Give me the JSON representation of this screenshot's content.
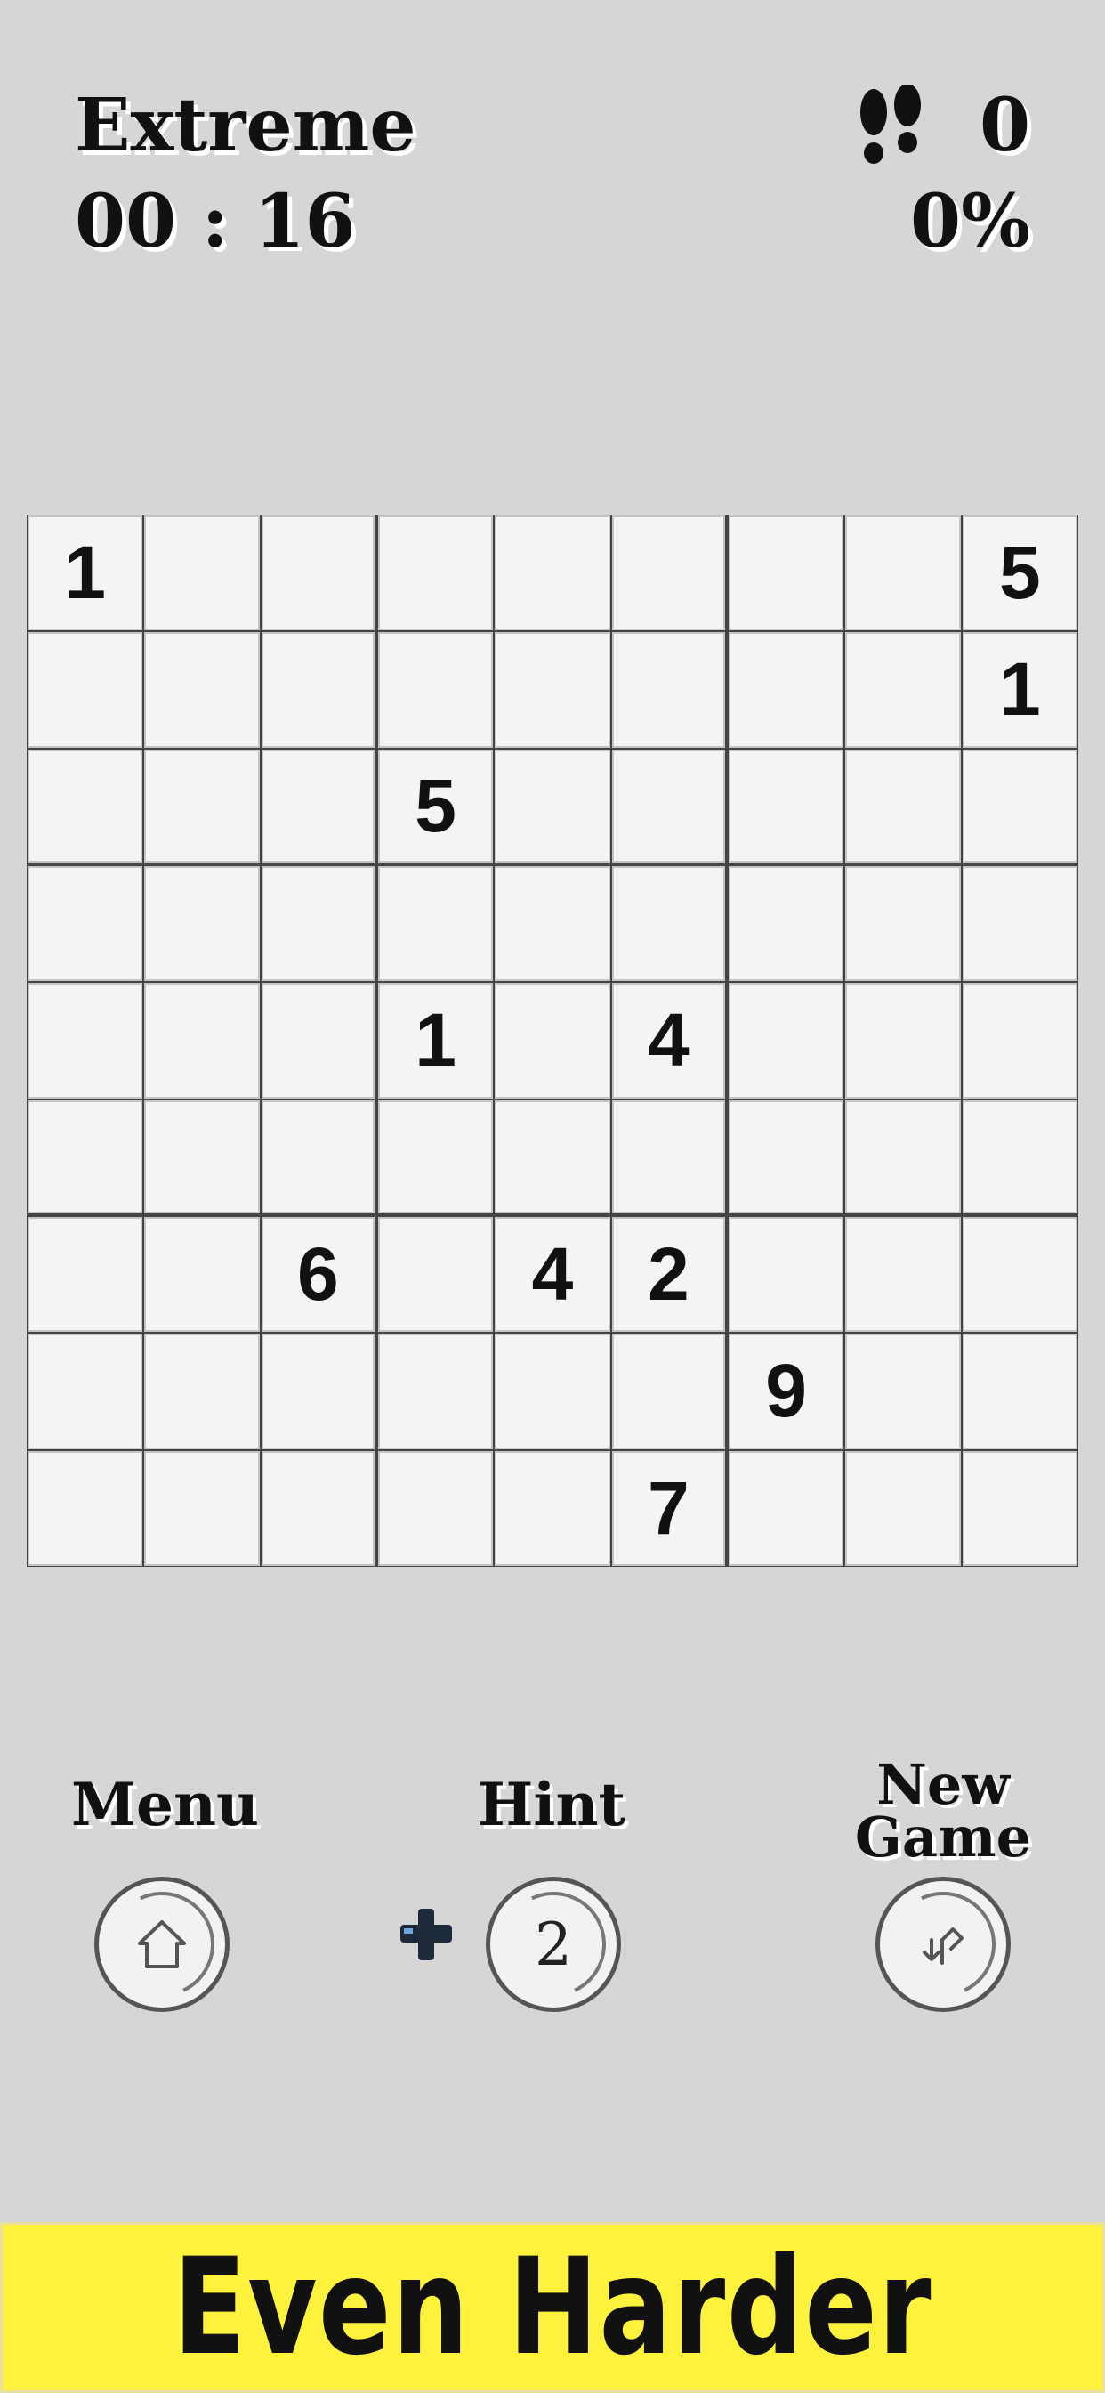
{
  "header": {
    "difficulty": "Extreme",
    "timer": "00 : 16",
    "moves": "0",
    "progress": "0%",
    "moves_icon": "footsteps-icon"
  },
  "board": [
    [
      "1",
      "",
      "",
      "",
      "",
      "",
      "",
      "",
      "5"
    ],
    [
      "",
      "",
      "",
      "",
      "",
      "",
      "",
      "",
      "1"
    ],
    [
      "",
      "",
      "",
      "5",
      "",
      "",
      "",
      "",
      ""
    ],
    [
      "",
      "",
      "",
      "",
      "",
      "",
      "",
      "",
      ""
    ],
    [
      "",
      "",
      "",
      "1",
      "",
      "4",
      "",
      "",
      ""
    ],
    [
      "",
      "",
      "",
      "",
      "",
      "",
      "",
      "",
      ""
    ],
    [
      "",
      "",
      "6",
      "",
      "4",
      "2",
      "",
      "",
      ""
    ],
    [
      "",
      "",
      "",
      "",
      "",
      "",
      "9",
      "",
      ""
    ],
    [
      "",
      "",
      "",
      "",
      "",
      "7",
      "",
      "",
      ""
    ]
  ],
  "controls": {
    "menu_label": "Menu",
    "menu_icon": "home-icon",
    "hint_label": "Hint",
    "hint_count": "2",
    "hint_plus_icon": "plus-icon",
    "new_game_label_line1": "New",
    "new_game_label_line2": "Game",
    "new_game_icon": "refresh-icon"
  },
  "banner": {
    "text": "Even Harder",
    "background": "#fff23d"
  }
}
